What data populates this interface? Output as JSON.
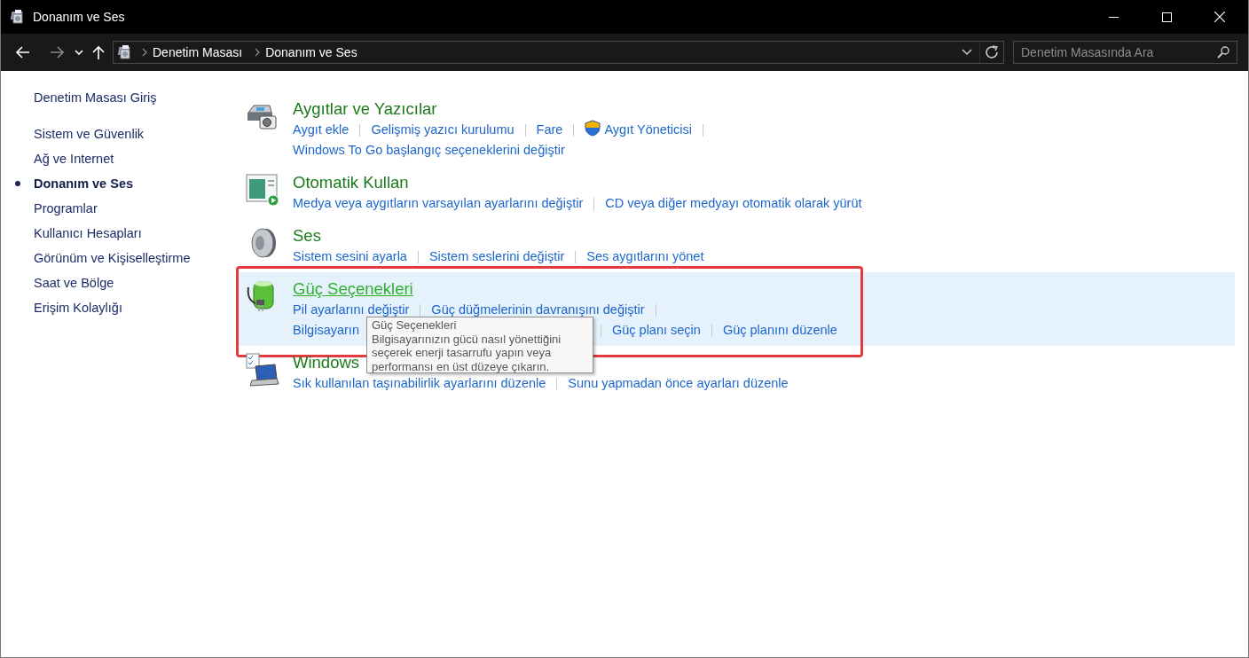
{
  "window": {
    "title": "Donanım ve Ses"
  },
  "address_bar": {
    "breadcrumbs": [
      "Denetim Masası",
      "Donanım ve Ses"
    ]
  },
  "search": {
    "placeholder": "Denetim Masasında Ara"
  },
  "sidebar": {
    "items": [
      {
        "label": "Denetim Masası Giriş",
        "kind": "home",
        "selected": false
      },
      {
        "label": "Sistem ve Güvenlik",
        "kind": "category",
        "selected": false
      },
      {
        "label": "Ağ ve Internet",
        "kind": "category",
        "selected": false
      },
      {
        "label": "Donanım ve Ses",
        "kind": "category",
        "selected": true
      },
      {
        "label": "Programlar",
        "kind": "category",
        "selected": false
      },
      {
        "label": "Kullanıcı Hesapları",
        "kind": "category",
        "selected": false
      },
      {
        "label": "Görünüm ve Kişiselleştirme",
        "kind": "category",
        "selected": false
      },
      {
        "label": "Saat ve Bölge",
        "kind": "category",
        "selected": false
      },
      {
        "label": "Erişim Kolaylığı",
        "kind": "category",
        "selected": false
      }
    ]
  },
  "sections": [
    {
      "kind": "devices",
      "title": "Aygıtlar ve Yazıcılar",
      "hovered": false,
      "outlined": false,
      "lines": [
        [
          {
            "text": "Aygıt ekle",
            "kind": "link"
          },
          {
            "text": "Gelişmiş yazıcı kurulumu",
            "kind": "link"
          },
          {
            "text": "Fare",
            "kind": "link"
          },
          {
            "text": "Aygıt Yöneticisi",
            "kind": "admin-link"
          }
        ],
        [
          {
            "text": "Windows To Go başlangıç seçeneklerini değiştir",
            "kind": "link"
          }
        ]
      ]
    },
    {
      "kind": "autoplay",
      "title": "Otomatik Kullan",
      "hovered": false,
      "outlined": false,
      "lines": [
        [
          {
            "text": "Medya veya aygıtların varsayılan ayarlarını değiştir",
            "kind": "link"
          },
          {
            "text": "CD veya diğer medyayı otomatik olarak yürüt",
            "kind": "link"
          }
        ]
      ]
    },
    {
      "kind": "sound",
      "title": "Ses",
      "hovered": false,
      "outlined": false,
      "lines": [
        [
          {
            "text": "Sistem sesini ayarla",
            "kind": "link"
          },
          {
            "text": "Sistem seslerini değiştir",
            "kind": "link"
          },
          {
            "text": "Ses aygıtlarını yönet",
            "kind": "link"
          }
        ]
      ]
    },
    {
      "kind": "power",
      "title": "Güç Seçenekleri",
      "hovered": true,
      "outlined": true,
      "lines": [
        [
          {
            "text": "Pil ayarlarını değiştir",
            "kind": "link"
          },
          {
            "text": "Güç düğmelerinin davranışını değiştir",
            "kind": "link"
          }
        ],
        [
          {
            "text": "Bilgisayarın",
            "kind": "cut-link"
          },
          {
            "text": "Güç planı seçin",
            "kind": "link"
          },
          {
            "text": "Güç planını düzenle",
            "kind": "link"
          }
        ]
      ]
    },
    {
      "kind": "mobility",
      "title": "Windows",
      "hovered": false,
      "outlined": false,
      "lines": [
        [
          {
            "text": "Sık kullanılan taşınabilirlik ayarlarını düzenle",
            "kind": "link"
          },
          {
            "text": "Sunu yapmadan önce ayarları düzenle",
            "kind": "link"
          }
        ]
      ]
    }
  ],
  "tooltip": {
    "title": "Güç Seçenekleri",
    "text": "Bilgisayarınızın gücü nasıl yönettiğini seçerek enerji tasarrufu yapın veya performansı en üst düzeye çıkarın."
  }
}
